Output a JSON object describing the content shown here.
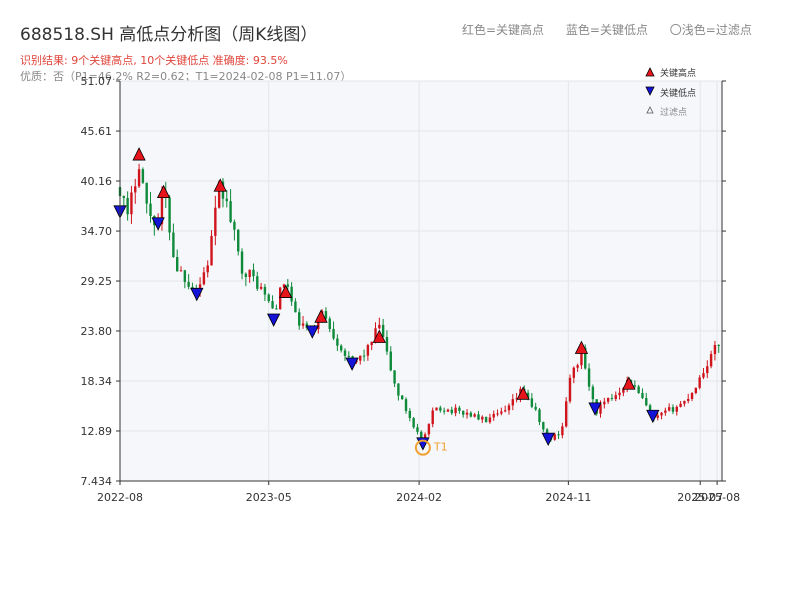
{
  "header": {
    "title": "688518.SH 高低点分析图（周K线图）",
    "subtitle": "识别结果: 9个关键高点, 10个关键低点  准确度: 93.5%",
    "quality": "优质：否（P1=46.2%  R2=0.62；T1=2024-02-08 P1=11.07）",
    "legend_top": [
      "红色=关键高点",
      "蓝色=关键低点",
      "〇浅色=过滤点"
    ]
  },
  "colors": {
    "up": "#d0141c",
    "down": "#0e8a3a",
    "high_marker": "#e8141c",
    "low_marker": "#1414d8",
    "t1_marker": "#f0a030",
    "plot_bg": "#f5f7fa",
    "grid": "#e3e6ea"
  },
  "chart_data": {
    "type": "candlestick",
    "x_ticks": [
      "2022-08",
      "2023-05",
      "2024-02",
      "2024-11",
      "2025-07",
      "2025-08"
    ],
    "x_tick_dates": [
      "2022-08-01",
      "2023-05-01",
      "2024-02-01",
      "2024-11-01",
      "2025-07-01",
      "2025-08-01"
    ],
    "x_range": [
      "2022-08-01",
      "2025-08-10"
    ],
    "y_ticks": [
      "7.434",
      "12.89",
      "18.34",
      "23.80",
      "29.25",
      "34.70",
      "40.16",
      "45.61",
      "51.07"
    ],
    "ylim": [
      7.434,
      51.07
    ],
    "grid": true,
    "legend": {
      "placement": "top-right",
      "entries": [
        "关键高点",
        "关键低点",
        "过滤点"
      ]
    },
    "close_path": [
      [
        "2022-08-01",
        39.5
      ],
      [
        "2022-08-15",
        36.0
      ],
      [
        "2022-09-05",
        42.5
      ],
      [
        "2022-09-20",
        37.0
      ],
      [
        "2022-10-10",
        35.5
      ],
      [
        "2022-10-20",
        39.5
      ],
      [
        "2022-11-10",
        31.0
      ],
      [
        "2022-12-01",
        29.5
      ],
      [
        "2022-12-20",
        28.0
      ],
      [
        "2023-01-10",
        31.5
      ],
      [
        "2023-02-01",
        40.0
      ],
      [
        "2023-02-20",
        36.0
      ],
      [
        "2023-03-10",
        31.0
      ],
      [
        "2023-04-10",
        29.0
      ],
      [
        "2023-05-10",
        26.0
      ],
      [
        "2023-06-01",
        29.5
      ],
      [
        "2023-06-20",
        25.0
      ],
      [
        "2023-07-20",
        23.5
      ],
      [
        "2023-08-05",
        26.0
      ],
      [
        "2023-09-01",
        23.0
      ],
      [
        "2023-10-01",
        20.0
      ],
      [
        "2023-11-01",
        22.0
      ],
      [
        "2023-11-20",
        24.5
      ],
      [
        "2023-12-20",
        17.5
      ],
      [
        "2024-02-08",
        11.5
      ],
      [
        "2024-03-01",
        15.5
      ],
      [
        "2024-05-01",
        14.8
      ],
      [
        "2024-06-01",
        14.0
      ],
      [
        "2024-07-10",
        15.0
      ],
      [
        "2024-08-10",
        17.5
      ],
      [
        "2024-09-01",
        15.0
      ],
      [
        "2024-09-25",
        11.8
      ],
      [
        "2024-10-20",
        13.0
      ],
      [
        "2024-11-01",
        18.0
      ],
      [
        "2024-11-25",
        21.5
      ],
      [
        "2024-12-20",
        15.0
      ],
      [
        "2025-01-20",
        16.5
      ],
      [
        "2025-02-20",
        18.5
      ],
      [
        "2025-03-20",
        16.0
      ],
      [
        "2025-04-05",
        14.0
      ],
      [
        "2025-05-01",
        15.0
      ],
      [
        "2025-06-01",
        16.0
      ],
      [
        "2025-06-20",
        17.5
      ],
      [
        "2025-07-20",
        21.0
      ],
      [
        "2025-08-05",
        22.5
      ]
    ],
    "key_highs": [
      {
        "date": "2022-09-05",
        "price": 43.1
      },
      {
        "date": "2022-10-20",
        "price": 39.0
      },
      {
        "date": "2023-02-01",
        "price": 39.7
      },
      {
        "date": "2023-06-01",
        "price": 28.1
      },
      {
        "date": "2023-08-05",
        "price": 25.4
      },
      {
        "date": "2023-11-20",
        "price": 23.2
      },
      {
        "date": "2024-08-10",
        "price": 17.0
      },
      {
        "date": "2024-11-25",
        "price": 22.0
      },
      {
        "date": "2025-02-20",
        "price": 18.1
      }
    ],
    "key_lows": [
      {
        "date": "2022-08-01",
        "price": 36.8
      },
      {
        "date": "2022-10-10",
        "price": 35.5
      },
      {
        "date": "2022-12-20",
        "price": 27.8
      },
      {
        "date": "2023-05-10",
        "price": 25.0
      },
      {
        "date": "2023-07-20",
        "price": 23.7
      },
      {
        "date": "2023-10-01",
        "price": 20.2
      },
      {
        "date": "2024-02-08",
        "price": 11.5
      },
      {
        "date": "2024-09-25",
        "price": 12.0
      },
      {
        "date": "2024-12-20",
        "price": 15.3
      },
      {
        "date": "2025-04-05",
        "price": 14.5
      }
    ],
    "t1": {
      "label": "T1",
      "date": "2024-02-08",
      "price": 11.07
    }
  }
}
